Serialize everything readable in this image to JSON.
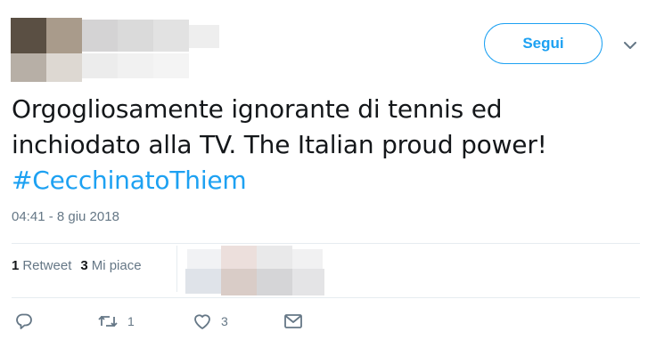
{
  "header": {
    "follow_label": "Segui",
    "menu_icon": "chevron-down-icon"
  },
  "tweet": {
    "text_line1": "Orgogliosamente ignorante di tennis ed",
    "text_line2": "inchiodato alla TV. The Italian proud power!",
    "hashtag": "#CecchinatoThiem",
    "timestamp": "04:41 - 8 giu 2018"
  },
  "stats": {
    "retweets_count": "1",
    "retweets_label": "Retweet",
    "likes_count": "3",
    "likes_label": "Mi piace"
  },
  "actions": {
    "reply_icon": "reply-icon",
    "retweet_icon": "retweet-icon",
    "retweet_count": "1",
    "like_icon": "heart-icon",
    "like_count": "3",
    "message_icon": "envelope-icon"
  },
  "colors": {
    "accent": "#1da1f2",
    "muted": "#657786",
    "text": "#14171a",
    "divider": "#e6ecf0"
  }
}
